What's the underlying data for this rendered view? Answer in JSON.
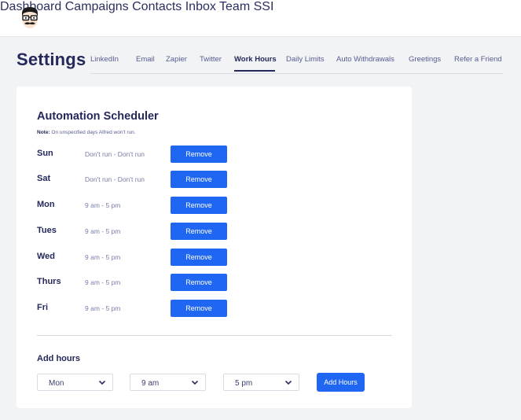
{
  "app": {
    "logo_icon": "mustache-glasses-face-icon"
  },
  "nav": {
    "items": [
      {
        "label": "Dashboard"
      },
      {
        "label": "Campaigns"
      },
      {
        "label": "Contacts"
      },
      {
        "label": "Inbox"
      },
      {
        "label": "Team"
      },
      {
        "label": "SSI"
      }
    ]
  },
  "settings": {
    "title": "Settings",
    "tabs": [
      {
        "label": "LinkedIn"
      },
      {
        "label": "Email"
      },
      {
        "label": "Zapier"
      },
      {
        "label": "Twitter"
      },
      {
        "label": "Work Hours",
        "active": true
      },
      {
        "label": "Daily Limits"
      },
      {
        "label": "Auto Withdrawals"
      },
      {
        "label": "Greetings"
      },
      {
        "label": "Refer a Friend"
      }
    ]
  },
  "scheduler": {
    "title": "Automation Scheduler",
    "note_label": "Note:",
    "note_text": " On unspecified days Alfred won't run.",
    "remove_label": "Remove",
    "days": [
      {
        "day": "Sun",
        "hours": "Don't run - Don't run"
      },
      {
        "day": "Sat",
        "hours": "Don't run - Don't run"
      },
      {
        "day": "Mon",
        "hours": "9 am - 5 pm"
      },
      {
        "day": "Tues",
        "hours": "9 am - 5 pm"
      },
      {
        "day": "Wed",
        "hours": "9 am - 5 pm"
      },
      {
        "day": "Thurs",
        "hours": "9 am - 5 pm"
      },
      {
        "day": "Fri",
        "hours": "9 am - 5 pm"
      }
    ]
  },
  "add_hours": {
    "title": "Add hours",
    "day_select": "Mon",
    "start_select": "9 am",
    "end_select": "5 pm",
    "button_label": "Add Hours"
  },
  "colors": {
    "primary_button": "#1f66f2",
    "heading": "#25285a",
    "background": "#f2f3f5"
  }
}
